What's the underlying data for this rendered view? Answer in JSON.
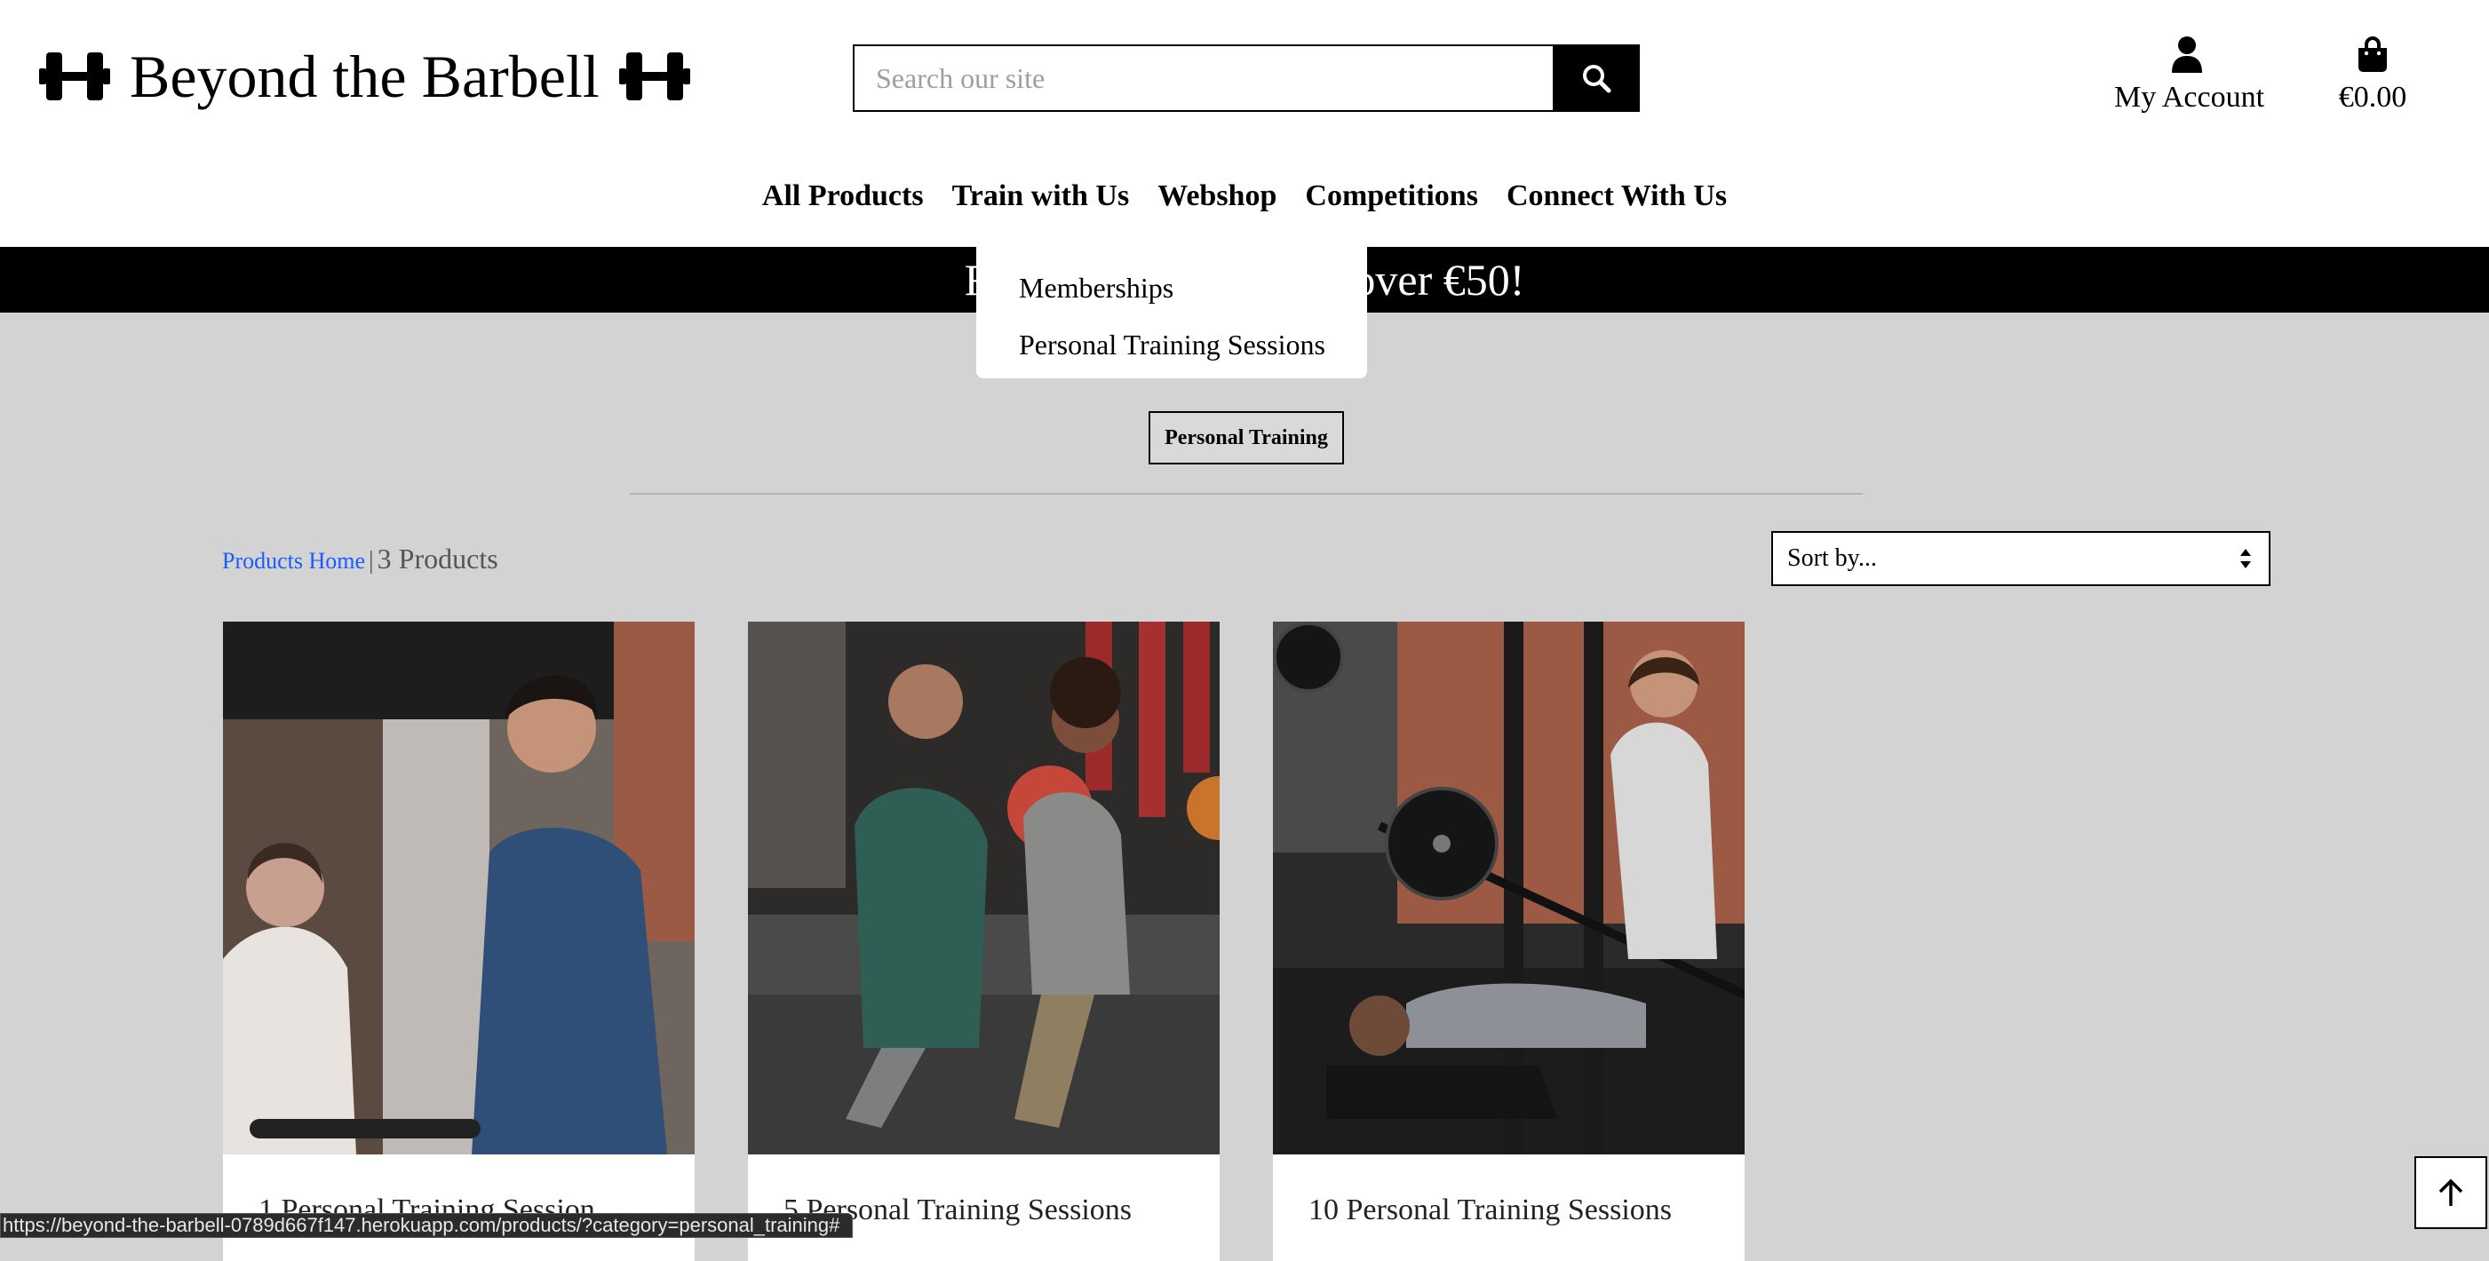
{
  "header": {
    "logo_text": "Beyond the Barbell",
    "search": {
      "placeholder": "Search our site",
      "value": ""
    },
    "account_label": "My Account",
    "cart_total": "€0.00"
  },
  "nav": {
    "items": [
      {
        "label": "All Products"
      },
      {
        "label": "Train with Us"
      },
      {
        "label": "Webshop"
      },
      {
        "label": "Competitions"
      },
      {
        "label": "Connect With Us"
      }
    ]
  },
  "banner": {
    "visible_left": "F",
    "visible_right": "over €50!"
  },
  "dropdown": {
    "items": [
      {
        "label": "Memberships"
      },
      {
        "label": "Personal Training Sessions"
      }
    ]
  },
  "category_filter": {
    "label": "Personal Training"
  },
  "breadcrumb": {
    "home_link": "Products Home",
    "separator": "|",
    "count_text": "3 Products"
  },
  "sort": {
    "selected": "Sort by..."
  },
  "products": [
    {
      "title": "1 Personal Training Session"
    },
    {
      "title": "5 Personal Training Sessions"
    },
    {
      "title": "10 Personal Training Sessions"
    }
  ],
  "status_bar": {
    "url": "https://beyond-the-barbell-0789d667f147.herokuapp.com/products/?category=personal_training#"
  },
  "colors": {
    "accent_link": "#1a5cff",
    "page_background": "#d3d3d3",
    "banner_background": "#000000"
  },
  "icons": {
    "logo": "dumbbell-icon",
    "search": "magnifier-icon",
    "account": "user-icon",
    "cart": "shopping-bag-icon",
    "sort": "sort-arrows-icon",
    "back_to_top": "arrow-up-icon"
  }
}
